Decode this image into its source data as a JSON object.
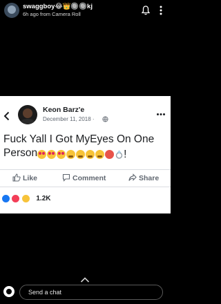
{
  "story": {
    "username": "swaggboy😂👑🔘🔘kj",
    "time": "6h ago from Camera Roll"
  },
  "post": {
    "author": "Keon Barz'e",
    "date": "December 11, 2018 ·",
    "text": "Fuck Yall I Got MyEyes On One Person",
    "text_suffix": "!",
    "emoji_icons": [
      "heart-eyes-emoji",
      "heart-eyes-emoji",
      "heart-eyes-emoji",
      "tired-face-emoji",
      "tired-face-emoji",
      "tired-face-emoji",
      "tired-face-emoji",
      "hot-face-emoji",
      "ring-emoji"
    ],
    "actions": {
      "like": "Like",
      "comment": "Comment",
      "share": "Share"
    },
    "reaction_icons": [
      "like-reaction-icon",
      "love-reaction-icon",
      "haha-reaction-icon"
    ],
    "reaction_count": "1.2K"
  },
  "chat": {
    "placeholder": "Send a chat"
  },
  "colors": {
    "background": "#000000",
    "card": "#ffffff",
    "fb_text": "#1c1e21",
    "fb_secondary": "#606770",
    "like_blue": "#1877f2",
    "love_red": "#f33e58"
  }
}
